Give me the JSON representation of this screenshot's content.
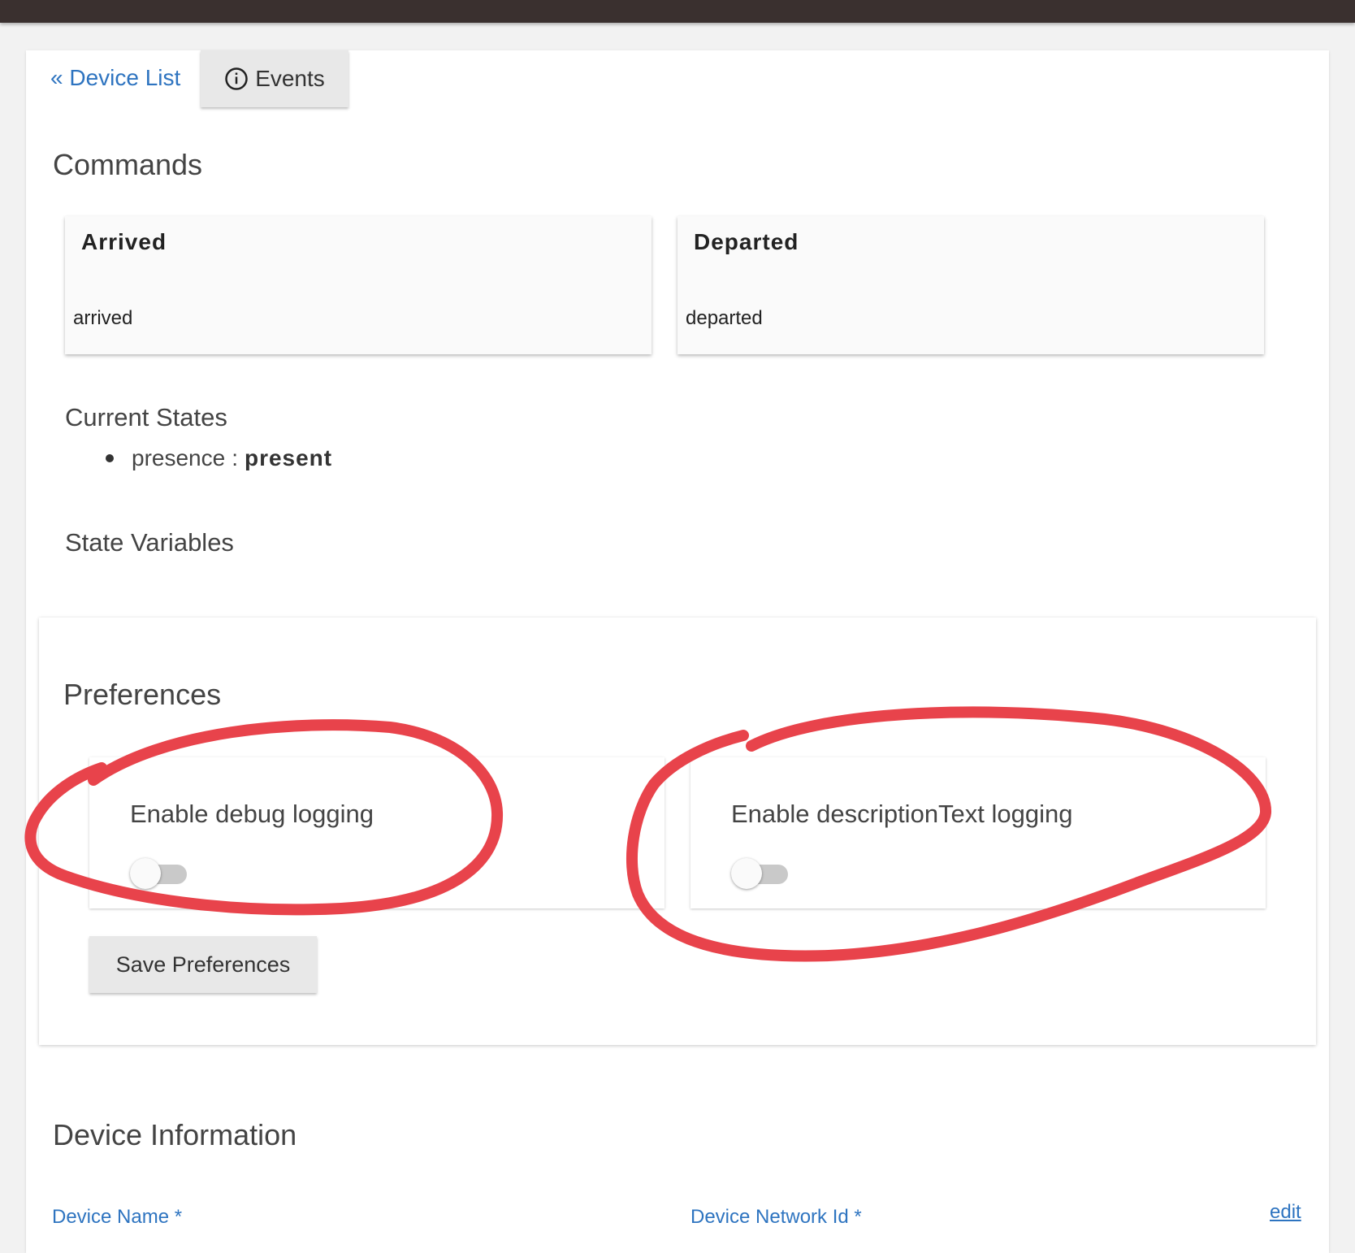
{
  "nav": {
    "back_link": "« Device List",
    "events_button": "Events",
    "events_icon": "info-circle-icon"
  },
  "commands": {
    "title": "Commands",
    "items": [
      {
        "title": "Arrived",
        "command": "arrived"
      },
      {
        "title": "Departed",
        "command": "departed"
      }
    ]
  },
  "current_states": {
    "title": "Current States",
    "items": [
      {
        "name": "presence",
        "separator": ":",
        "value": "present"
      }
    ]
  },
  "state_variables": {
    "title": "State Variables"
  },
  "preferences": {
    "title": "Preferences",
    "items": [
      {
        "label": "Enable debug logging",
        "enabled": false
      },
      {
        "label": "Enable descriptionText logging",
        "enabled": false
      }
    ],
    "save_button": "Save Preferences"
  },
  "device_information": {
    "title": "Device Information",
    "fields": [
      {
        "label": "Device Name *"
      },
      {
        "label": "Device Network Id *"
      }
    ],
    "edit_link": "edit"
  },
  "colors": {
    "topbar": "#3a302f",
    "link": "#2e74c0",
    "annotation": "#e8434b"
  }
}
